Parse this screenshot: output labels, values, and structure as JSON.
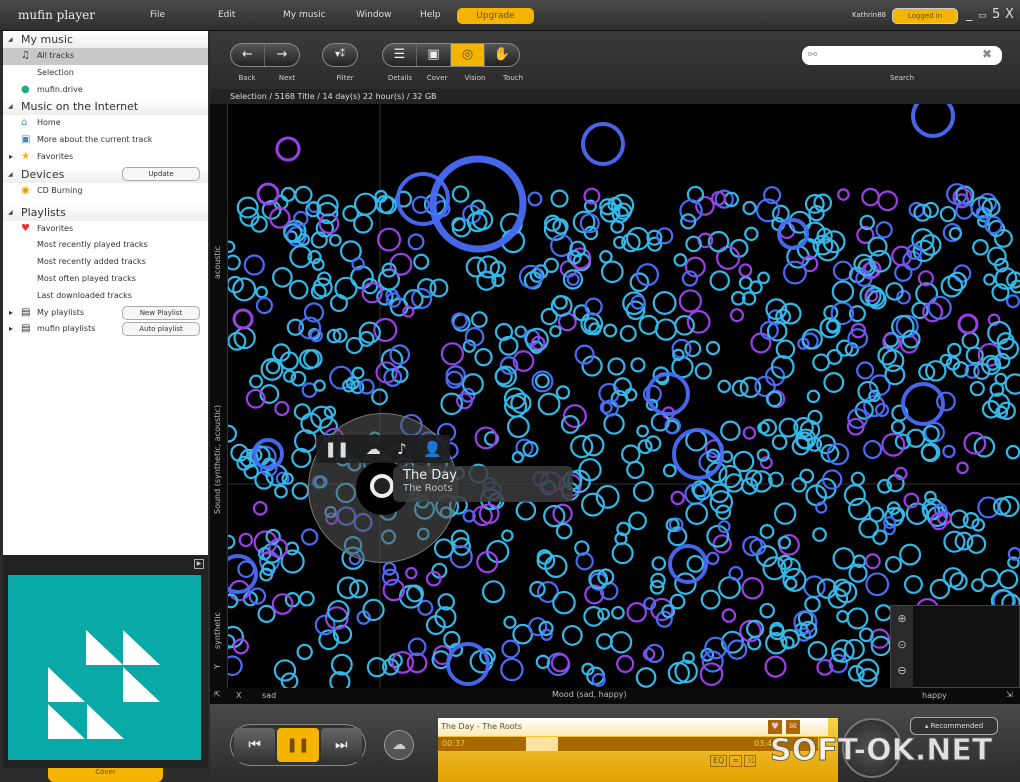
{
  "app": {
    "title": "mufin player",
    "menu": [
      "File",
      "Edit",
      "My music",
      "Window",
      "Help"
    ],
    "upgrade": "Upgrade",
    "user": "Kathrin88",
    "logged_in": "Logged in",
    "window_controls": [
      "_",
      "▭",
      "5",
      "X"
    ]
  },
  "sidebar": {
    "my_music": {
      "title": "My music",
      "items": [
        {
          "label": "All tracks",
          "icon": "music-note-icon"
        },
        {
          "label": "Selection"
        },
        {
          "label": "mufin.drive",
          "icon": "globe-icon"
        }
      ]
    },
    "internet": {
      "title": "Music on the Internet",
      "items": [
        {
          "label": "Home",
          "icon": "home-icon"
        },
        {
          "label": "More about the current track",
          "icon": "info-icon"
        },
        {
          "label": "Favorites",
          "icon": "star-icon"
        }
      ]
    },
    "devices": {
      "title": "Devices",
      "update": "Update",
      "items": [
        {
          "label": "CD Burning",
          "icon": "cd-icon"
        }
      ]
    },
    "playlists": {
      "title": "Playlists",
      "items": [
        {
          "label": "Favorites",
          "icon": "heart-icon"
        },
        {
          "label": "Most recently played tracks"
        },
        {
          "label": "Most recently added tracks"
        },
        {
          "label": "Most often played tracks"
        },
        {
          "label": "Last downloaded tracks"
        },
        {
          "label": "My playlists"
        },
        {
          "label": "mufin playlists"
        }
      ],
      "new_playlist": "New Playlist",
      "auto_playlist": "Auto playlist"
    }
  },
  "cover_panel": {
    "tab_label": "Cover",
    "accent": "#09a9a8"
  },
  "toolbar": {
    "buttons": [
      "Back",
      "Next",
      "Filter",
      "Details",
      "Cover",
      "Vision",
      "Touch"
    ],
    "active": "Vision",
    "search_label": "Search",
    "search_value": ""
  },
  "breadcrumb": "Selection / 5168 Title / 14 day(s) 22 hour(s) / 32 GB",
  "vision": {
    "y_axis": {
      "top": "acoustic",
      "title": "Sound (synthetic, acoustic)",
      "bottom": "synthetic",
      "letter": "Y"
    },
    "x_axis": {
      "letter": "X",
      "left": "sad",
      "title": "Mood (sad, happy)",
      "right": "happy"
    },
    "colors": {
      "cyan": "#35b8e8",
      "blue": "#4a6cf5",
      "violet": "#9b40e8"
    }
  },
  "popup": {
    "title": "The Day",
    "artist": "The Roots"
  },
  "player": {
    "now_playing": "The Day - The Roots",
    "elapsed": "00:37",
    "total": "03:41",
    "recommended": "Recommended",
    "progress": 0.17,
    "accent": "#f4b400"
  },
  "watermark": "SOFT-OK.NET"
}
